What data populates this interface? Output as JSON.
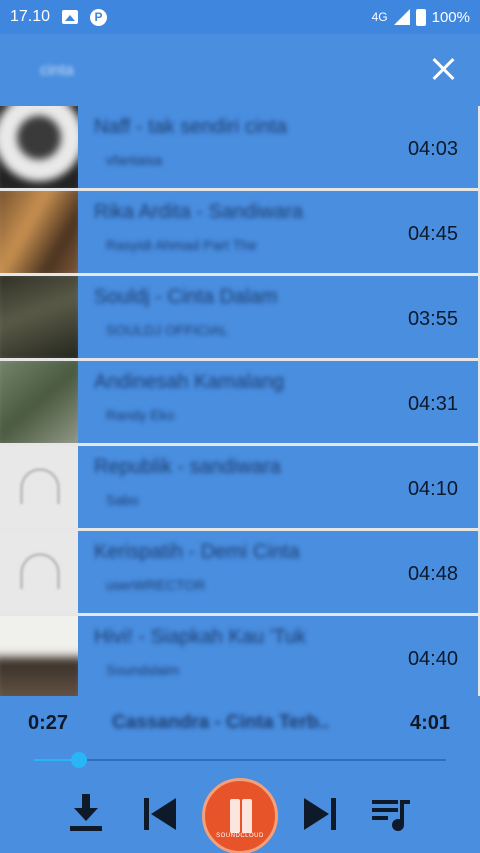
{
  "status_bar": {
    "time": "17.10",
    "network": "4G",
    "battery": "100%"
  },
  "header": {
    "search_text": "cinta"
  },
  "tracks": [
    {
      "title": "Naff - tak sendiri cinta",
      "artist": "vfantaisa",
      "duration": "04:03"
    },
    {
      "title": "Rika Ardita - Sandiwara",
      "artist": "Rasyidi Ahmad Part The",
      "duration": "04:45"
    },
    {
      "title": "Souldj - Cinta Dalam",
      "artist": "SOULDJ OFFICIAL",
      "duration": "03:55"
    },
    {
      "title": "Andinesah Kamalang",
      "artist": "Randy Eko",
      "duration": "04:31"
    },
    {
      "title": "Republik - sandiwara",
      "artist": "Sabo",
      "duration": "04:10"
    },
    {
      "title": "Kerispatih - Demi Cinta",
      "artist": "userWRECTOR",
      "duration": "04:48"
    },
    {
      "title": "Hivi! - Siapkah Kau 'Tuk",
      "artist": "Soundslaim",
      "duration": "04:40"
    }
  ],
  "player": {
    "current_time": "0:27",
    "total_time": "4:01",
    "now_playing_title": "Cassandra - Cinta Terb..",
    "progress": 0.11,
    "brand_label": "SOUNDCLOUD"
  },
  "icons": {
    "download": "download-icon",
    "previous": "skip-previous-icon",
    "play_pause": "pause-icon",
    "next": "skip-next-icon",
    "queue": "queue-music-icon"
  },
  "colors": {
    "primary": "#4a8ee0",
    "accent": "#29b6f6",
    "soundcloud": "#e8542a"
  }
}
